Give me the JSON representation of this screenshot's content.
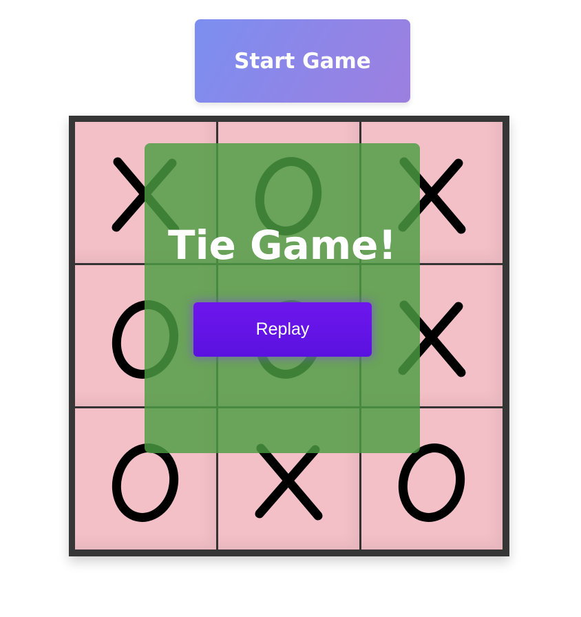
{
  "start_button": {
    "label": "Start Game"
  },
  "board": {
    "cells": [
      "X",
      "O",
      "X",
      "O",
      "O",
      "X",
      "O",
      "X",
      "O"
    ]
  },
  "result_overlay": {
    "message": "Tie Game!",
    "replay_label": "Replay"
  },
  "colors": {
    "cell_background": "#f4c0c8",
    "grid_line": "#333333",
    "overlay": "#4c9c42",
    "replay_button": "#6013e8",
    "start_gradient_from": "#7b8ff0",
    "start_gradient_to": "#9c7fdf",
    "mark": "#000000"
  }
}
